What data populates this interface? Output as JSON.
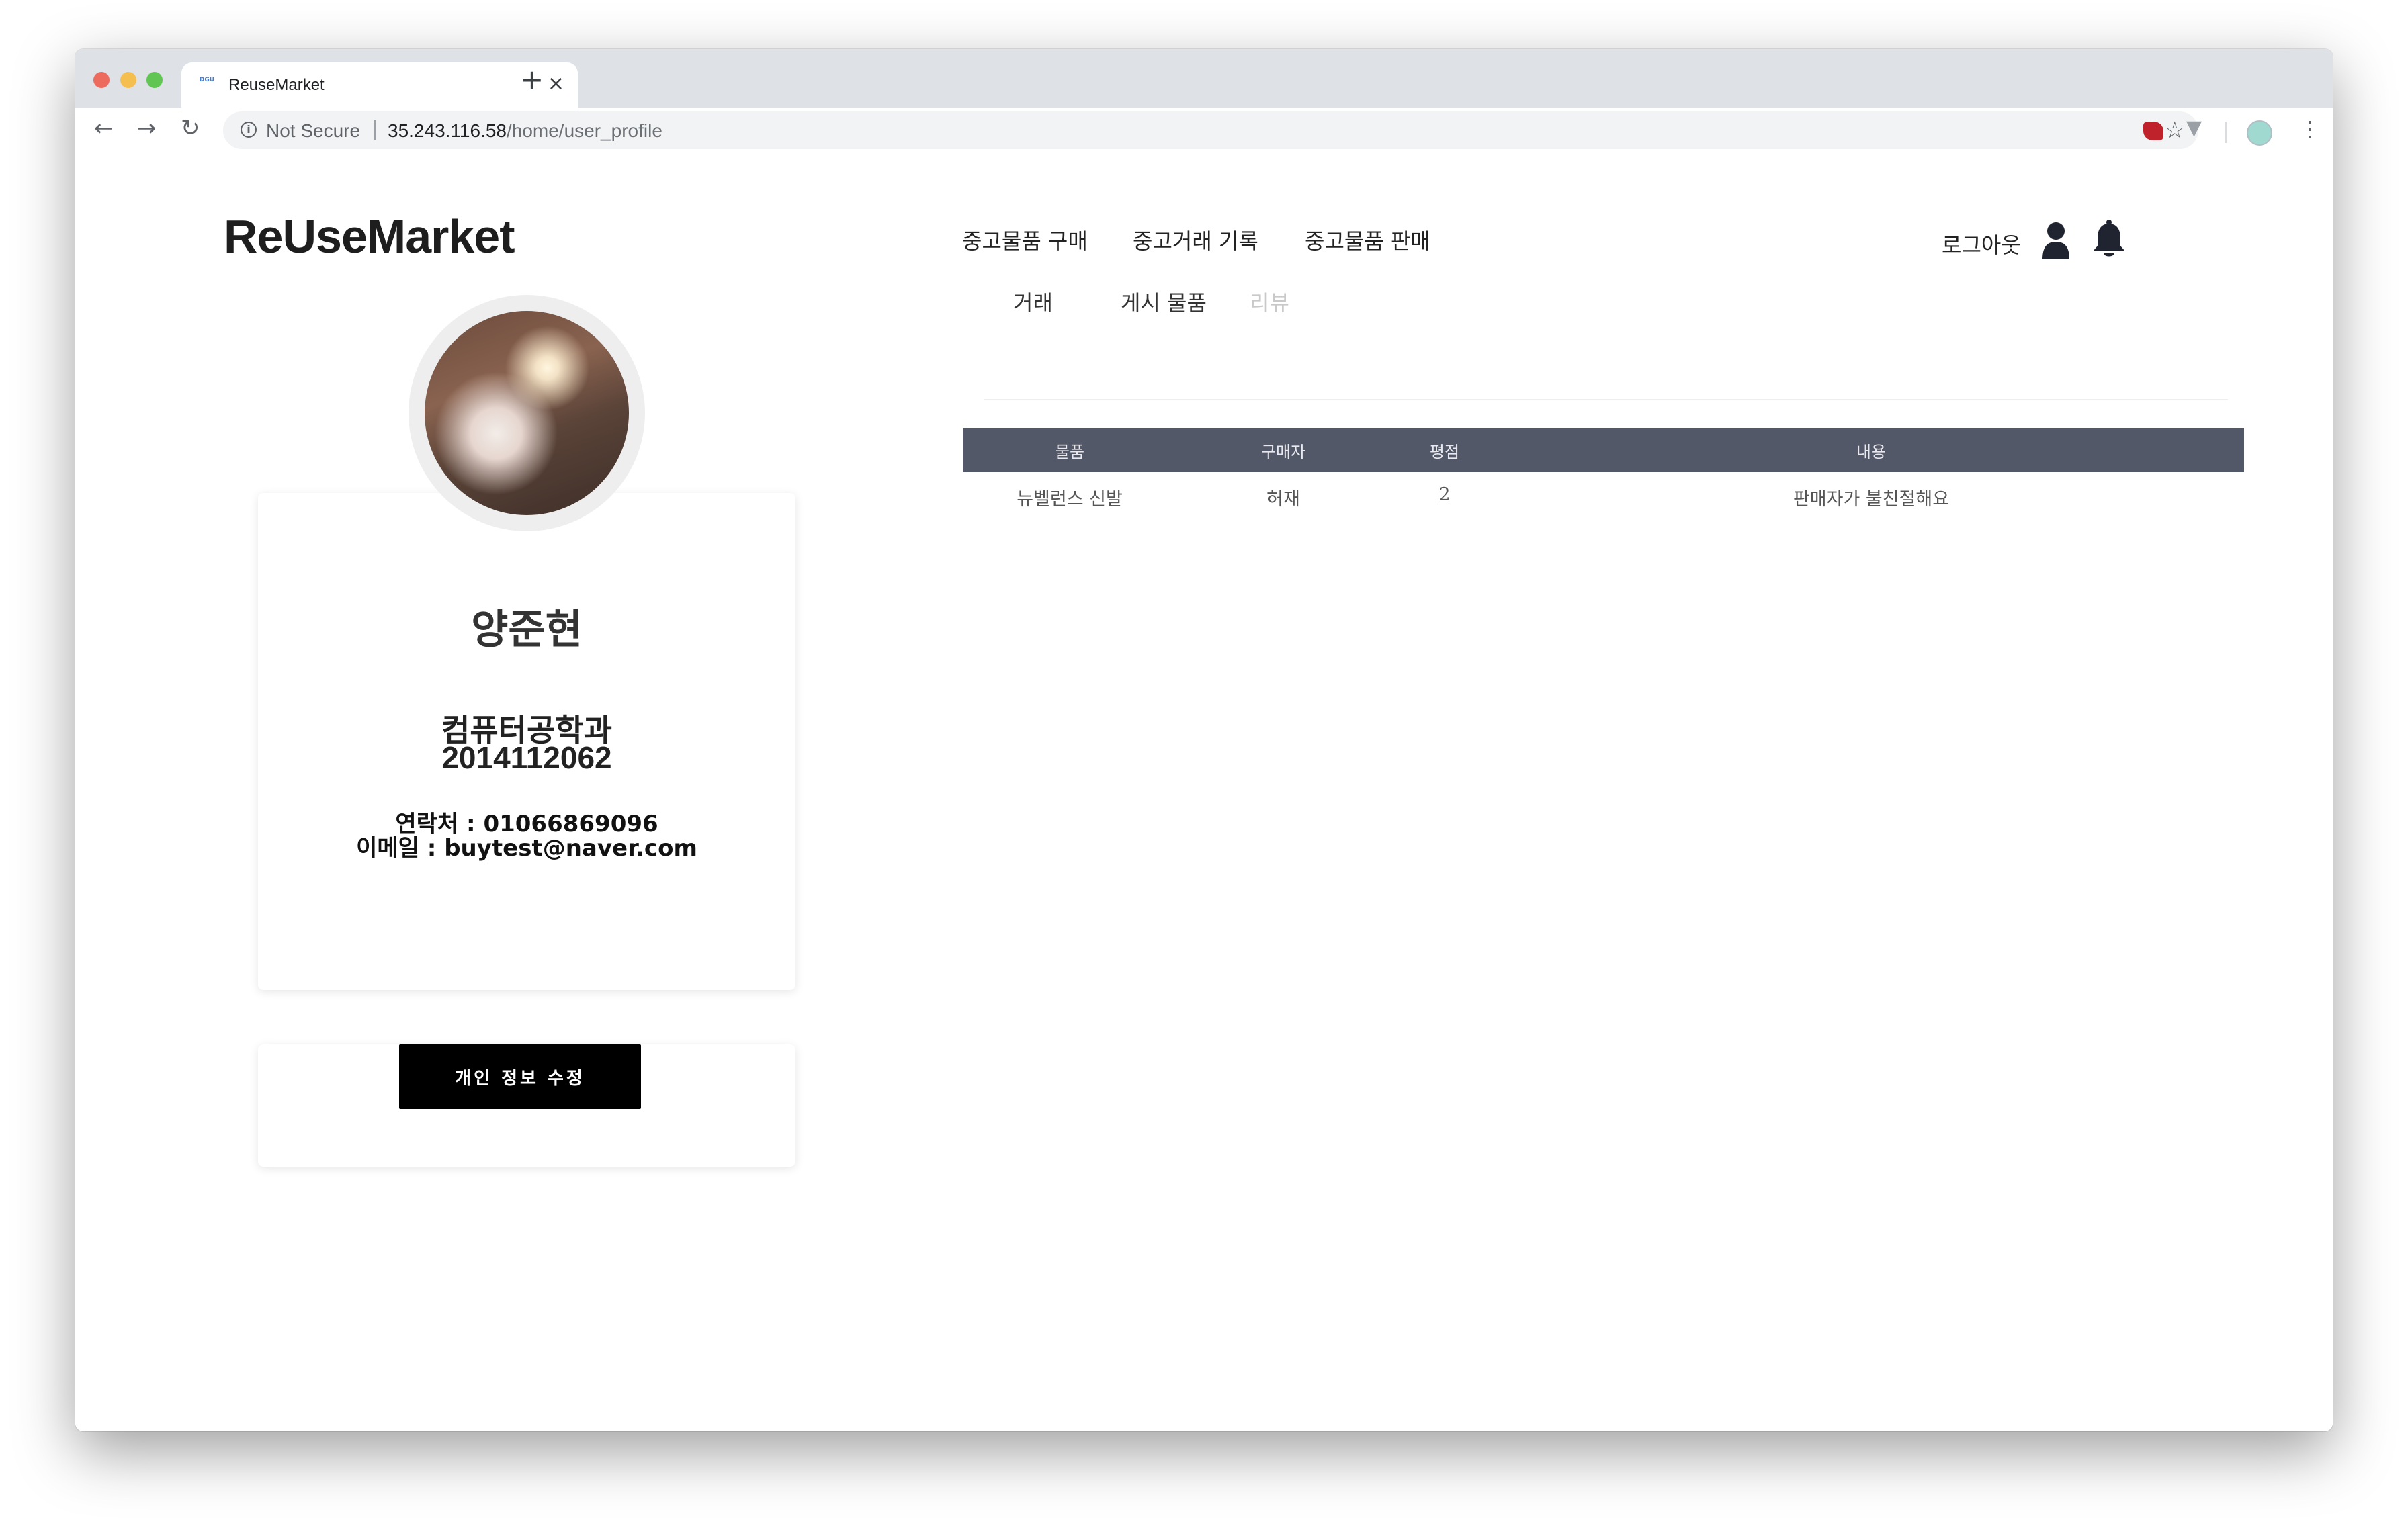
{
  "browser": {
    "tab_title": "ReuseMarket",
    "tab_favicon_text": "DGU",
    "tab_close": "×",
    "new_tab": "+",
    "back": "←",
    "forward": "→",
    "reload": "↻",
    "info": "i",
    "security_label": "Not Secure",
    "url_host": "35.243.116.58",
    "url_path": "/home/user_profile",
    "star": "☆",
    "ext2": "▼",
    "menu": "⋮"
  },
  "header": {
    "brand": "ReUseMarket",
    "nav": {
      "buy": "중고물품 구매",
      "history": "중고거래 기록",
      "sell": "중고물품 판매"
    },
    "logout": "로그아웃"
  },
  "sub_tabs": {
    "trade": "거래",
    "posted": "게시 물품",
    "review": "리뷰",
    "active": "review"
  },
  "reviews_table": {
    "columns": [
      "물품",
      "구매자",
      "평점",
      "내용"
    ],
    "rows": [
      [
        "뉴벨런스 신발",
        "허재",
        "2",
        "판매자가 불친절해요"
      ]
    ]
  },
  "profile": {
    "name": "양준현",
    "department": "컴퓨터공학과",
    "student_id": "2014112062",
    "contact": "연락처 : 01066869096",
    "email": "이메일 : buytest@naver.com",
    "edit_button": "개인 정보 수정"
  },
  "colors": {
    "table_header_bg": "#525868",
    "button_bg": "#000000",
    "inactive_tab": "#c9c9c9"
  }
}
